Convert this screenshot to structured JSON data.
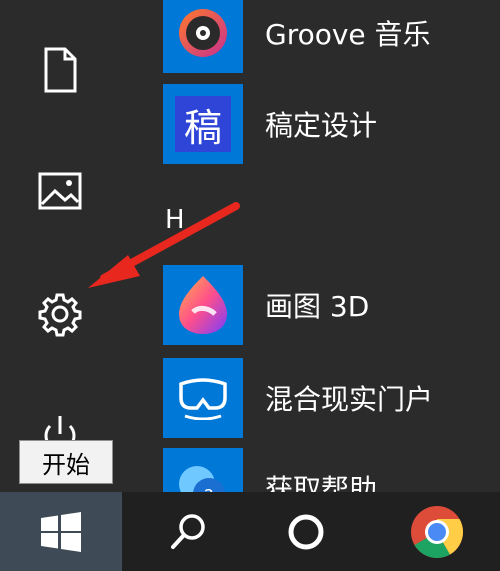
{
  "start_menu": {
    "rail_icons": [
      "document-icon",
      "pictures-icon",
      "settings-gear-icon",
      "power-icon"
    ],
    "apps": [
      {
        "label": "Groove 音乐",
        "icon": "groove-music-icon"
      },
      {
        "label": "稿定设计",
        "icon": "gaoding-icon",
        "tile_char": "稿"
      },
      {
        "label": "画图 3D",
        "icon": "paint-3d-icon"
      },
      {
        "label": "混合现实门户",
        "icon": "mixed-reality-icon"
      },
      {
        "label": "获取帮助",
        "icon": "get-help-icon"
      }
    ],
    "section_letter": "H",
    "tooltip": "开始"
  },
  "taskbar": {
    "items": [
      "windows-start-icon",
      "search-icon",
      "cortana-icon",
      "chrome-icon"
    ]
  },
  "colors": {
    "tile": "#0078d7",
    "annotation_arrow": "#e8281e",
    "taskbar": "#202020",
    "menu": "#2b2b2b"
  }
}
